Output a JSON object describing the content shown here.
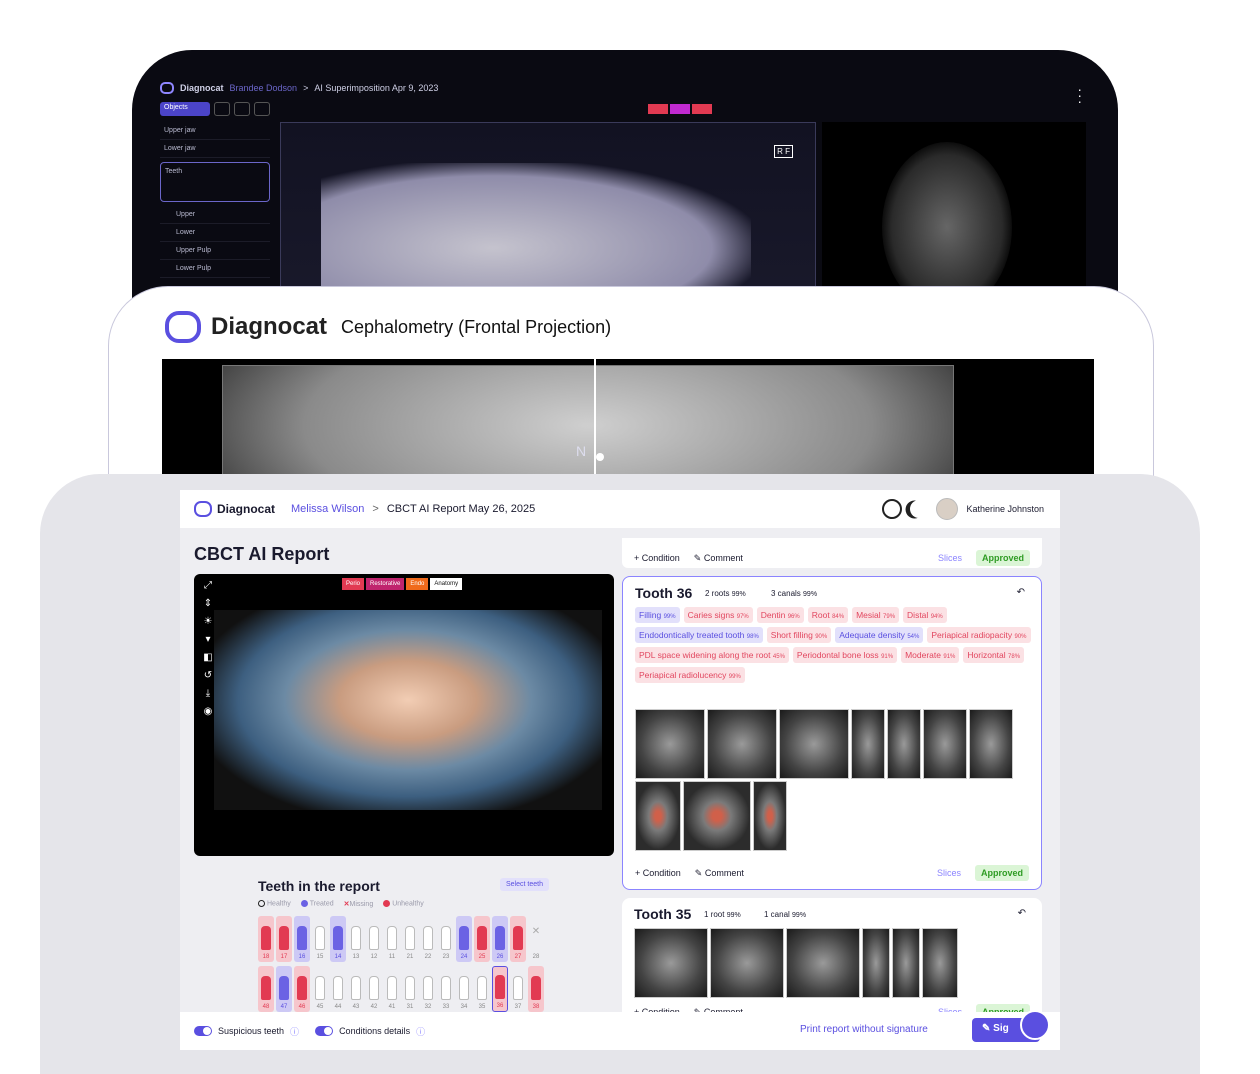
{
  "dev1": {
    "brand": "Diagnocat",
    "patient": "Brandee Dodson",
    "sep": ">",
    "report": "AI Superimposition Apr 9, 2023",
    "objects_label": "Objects",
    "layers": [
      "Upper jaw",
      "Lower jaw",
      "Teeth",
      "Upper",
      "Lower",
      "Upper Pulp",
      "Lower Pulp"
    ],
    "rf": "R F"
  },
  "dev2": {
    "brand": "Diagnocat",
    "title": "Cephalometry (Frontal Projection)",
    "landmark": "N"
  },
  "dev3": {
    "brand": "Diagnocat",
    "patient": "Melissa Wilson",
    "sep": ">",
    "report": "CBCT AI Report May 26, 2025",
    "user": "Katherine Johnston",
    "page_title": "CBCT AI Report",
    "pano_tabs": [
      "Perio",
      "Restorative",
      "Endo",
      "Anatomy"
    ],
    "teeth_title": "Teeth in the report",
    "select_teeth": "Select teeth",
    "legend": {
      "healthy": "Healthy",
      "treated": "Treated",
      "missing": "Missing",
      "unhealthy": "Unhealthy"
    },
    "upper_teeth": [
      {
        "n": "18",
        "s": "u"
      },
      {
        "n": "17",
        "s": "u"
      },
      {
        "n": "16",
        "s": "t"
      },
      {
        "n": "15",
        "s": "h"
      },
      {
        "n": "14",
        "s": "t"
      },
      {
        "n": "13",
        "s": "h"
      },
      {
        "n": "12",
        "s": "h"
      },
      {
        "n": "11",
        "s": "h"
      },
      {
        "n": "21",
        "s": "h"
      },
      {
        "n": "22",
        "s": "h"
      },
      {
        "n": "23",
        "s": "h"
      },
      {
        "n": "24",
        "s": "t"
      },
      {
        "n": "25",
        "s": "u"
      },
      {
        "n": "26",
        "s": "t"
      },
      {
        "n": "27",
        "s": "u"
      },
      {
        "n": "28",
        "s": "m"
      }
    ],
    "lower_teeth": [
      {
        "n": "48",
        "s": "u"
      },
      {
        "n": "47",
        "s": "t"
      },
      {
        "n": "46",
        "s": "u"
      },
      {
        "n": "45",
        "s": "h"
      },
      {
        "n": "44",
        "s": "h"
      },
      {
        "n": "43",
        "s": "h"
      },
      {
        "n": "42",
        "s": "h"
      },
      {
        "n": "41",
        "s": "h"
      },
      {
        "n": "31",
        "s": "h"
      },
      {
        "n": "32",
        "s": "h"
      },
      {
        "n": "33",
        "s": "h"
      },
      {
        "n": "34",
        "s": "h"
      },
      {
        "n": "35",
        "s": "h"
      },
      {
        "n": "36",
        "s": "u sel"
      },
      {
        "n": "37",
        "s": "h"
      },
      {
        "n": "38",
        "s": "u"
      }
    ],
    "prev_card": {
      "condition": "+ Condition",
      "comment": "Comment",
      "slices": "Slices",
      "approved": "Approved"
    },
    "tooth36": {
      "title": "Tooth 36",
      "roots": "2 roots",
      "roots_pct": "99%",
      "canals": "3 canals",
      "canals_pct": "99%",
      "tags": [
        {
          "t": "Filling",
          "p": "99%",
          "c": "p"
        },
        {
          "t": "Caries signs",
          "p": "97%",
          "c": "r"
        },
        {
          "t": "Dentin",
          "p": "96%",
          "c": "r"
        },
        {
          "t": "Root",
          "p": "84%",
          "c": "r"
        },
        {
          "t": "Mesial",
          "p": "79%",
          "c": "r"
        },
        {
          "t": "Distal",
          "p": "94%",
          "c": "r"
        },
        {
          "t": "Endodontically treated tooth",
          "p": "98%",
          "c": "p"
        },
        {
          "t": "Short filling",
          "p": "90%",
          "c": "r"
        },
        {
          "t": "Adequate density",
          "p": "54%",
          "c": "p"
        },
        {
          "t": "Periapical radiopacity",
          "p": "90%",
          "c": "r"
        },
        {
          "t": "PDL space widening along the root",
          "p": "45%",
          "c": "r"
        },
        {
          "t": "Periodontal bone loss",
          "p": "91%",
          "c": "r"
        },
        {
          "t": "Moderate",
          "p": "91%",
          "c": "r"
        },
        {
          "t": "Horizontal",
          "p": "78%",
          "c": "r"
        },
        {
          "t": "Periapical radiolucency",
          "p": "99%",
          "c": "r"
        }
      ],
      "condition": "+ Condition",
      "comment": "Comment",
      "slices": "Slices",
      "approved": "Approved"
    },
    "tooth35": {
      "title": "Tooth 35",
      "roots": "1 root",
      "roots_pct": "99%",
      "canals": "1 canal",
      "canals_pct": "99%",
      "condition": "+ Condition",
      "comment": "Comment",
      "slices": "Slices",
      "approved": "Approved"
    },
    "suspicious": "Suspicious teeth",
    "conditions_details": "Conditions details",
    "print": "Print report without signature",
    "sign": "Sig"
  }
}
